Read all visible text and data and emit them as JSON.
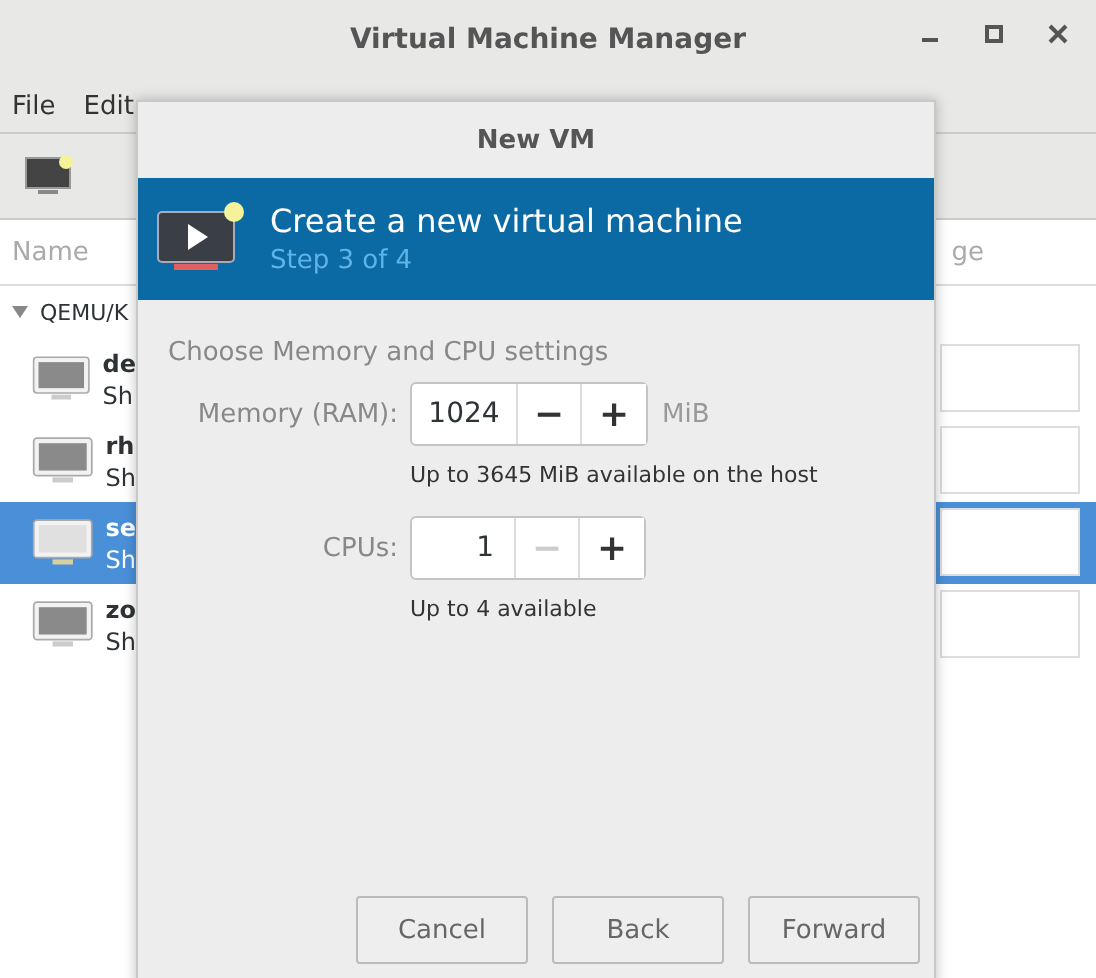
{
  "window": {
    "title": "Virtual Machine Manager"
  },
  "menu": [
    "File",
    "Edit"
  ],
  "columns": {
    "name": "Name",
    "column_2": "ge"
  },
  "tree": {
    "label": "QEMU/K",
    "expanded": true,
    "children": [
      {
        "name": "de",
        "status": "Sh",
        "selected": false
      },
      {
        "name": "rh",
        "status": "Sh",
        "selected": false
      },
      {
        "name": "se",
        "status": "Sh",
        "selected": true
      },
      {
        "name": "zo",
        "status": "Sh",
        "selected": false
      }
    ]
  },
  "dialog": {
    "title": "New VM",
    "heading": "Create a new virtual machine",
    "step": "Step 3 of 4",
    "section": "Choose Memory and CPU settings",
    "spinners": [
      {
        "label": "Memory (RAM):",
        "value": "1024",
        "unit": "MiB",
        "hint": "Up to 3645 MiB available on the host",
        "minus": "−",
        "plus": "+",
        "minus_disabled": false
      },
      {
        "label": "CPUs:",
        "value": "1",
        "hint": "Up to 4 available",
        "minus": "−",
        "plus": "+",
        "minus_disabled": true
      }
    ],
    "buttons": [
      "Cancel",
      "Back",
      "Forward"
    ]
  }
}
